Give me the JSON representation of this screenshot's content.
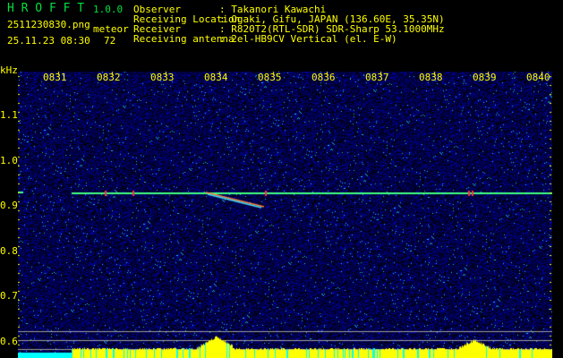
{
  "app": {
    "name": "H R O F F T",
    "version": "1.0.0"
  },
  "file": {
    "name": "2511230830.png",
    "datetime": "25.11.23 08:30"
  },
  "meteor": {
    "label": "meteor",
    "count": "72"
  },
  "info": [
    {
      "label": "Observer",
      "value": ": Takanori Kawachi"
    },
    {
      "label": "Receiving Location",
      "value": ": Ogaki, Gifu, JAPAN (136.60E, 35.35N)"
    },
    {
      "label": "Receiver",
      "value": ": R820T2(RTL-SDR) SDR-Sharp 53.1000MHz"
    },
    {
      "label": "Receiving antenna",
      "value": ": 2el-HB9CV Vertical (el. E-W)"
    }
  ],
  "axis": {
    "unit": "kHz",
    "x_ticks": [
      "0831",
      "0832",
      "0833",
      "0834",
      "0835",
      "0836",
      "0837",
      "0838",
      "0839",
      "0840"
    ],
    "y_ticks": [
      "1.1",
      "1.0",
      "0.9",
      "0.8",
      "0.7",
      "0.6"
    ]
  },
  "colors": {
    "text": "#ffff00",
    "title": "#00e040",
    "background": "#000000",
    "noise": "#1010a0",
    "signal": "#40ff80"
  }
}
